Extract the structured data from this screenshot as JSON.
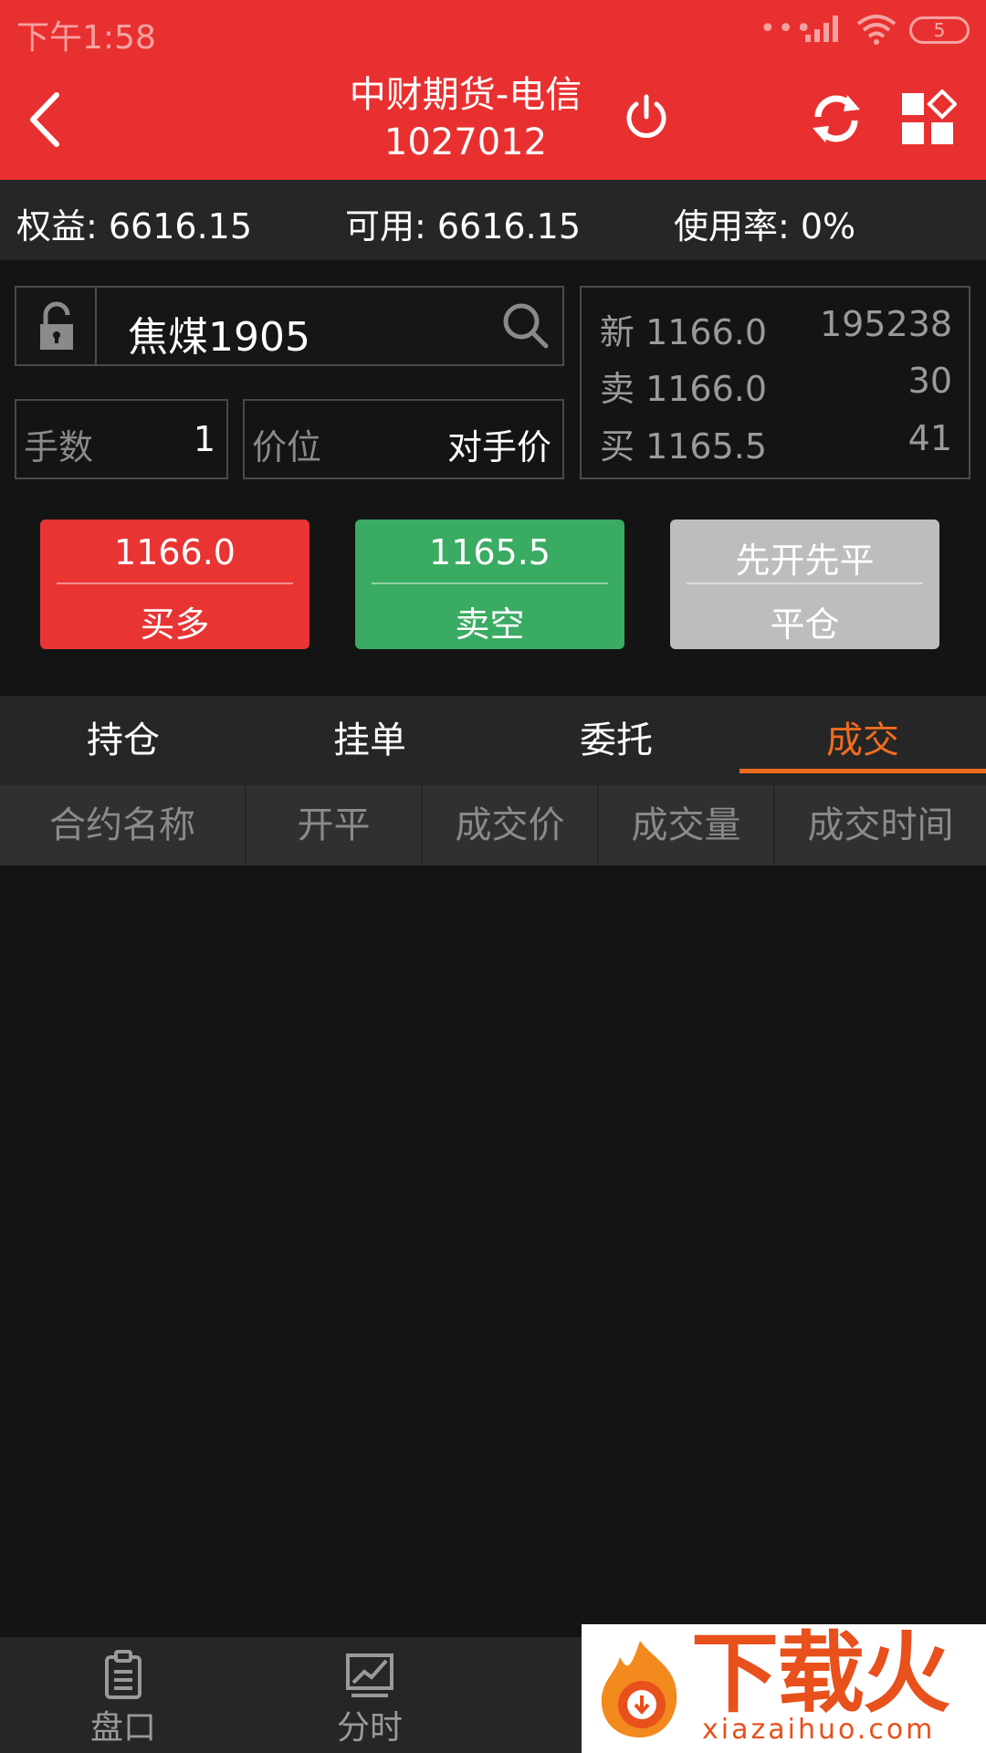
{
  "status_bar": {
    "time": "下午1:58",
    "dots": "•••",
    "battery": "5"
  },
  "header": {
    "title": "中财期货-电信1027012",
    "colors": {
      "bg": "#e93030"
    }
  },
  "account": {
    "equity": "权益: 6616.15",
    "available": "可用: 6616.15",
    "usage": "使用率: 0%"
  },
  "order": {
    "symbol": "焦煤1905",
    "qty_label": "手数",
    "qty_value": "1",
    "price_label": "价位",
    "price_value": "对手价"
  },
  "quote": {
    "rows": [
      {
        "label": "新 1166.0",
        "volume": "195238"
      },
      {
        "label": "卖 1166.0",
        "volume": "30"
      },
      {
        "label": "买 1165.5",
        "volume": "41"
      }
    ]
  },
  "actions": {
    "buy": {
      "price": "1166.0",
      "label": "买多",
      "color": "#e93434"
    },
    "sell": {
      "price": "1165.5",
      "label": "卖空",
      "color": "#3aab62"
    },
    "close": {
      "price": "先开先平",
      "label": "平仓",
      "color": "#bdbdbd"
    }
  },
  "tabs": [
    {
      "label": "持仓"
    },
    {
      "label": "挂单"
    },
    {
      "label": "委托"
    },
    {
      "label": "成交",
      "active": true
    }
  ],
  "table": {
    "columns": [
      "合约名称",
      "开平",
      "成交价",
      "成交量",
      "成交时间"
    ],
    "rows": []
  },
  "bottom_nav": [
    {
      "label": "盘口",
      "icon": "clipboard-icon"
    },
    {
      "label": "分时",
      "icon": "chart-icon"
    }
  ],
  "watermark": {
    "text": "下载火",
    "url": "xiazaihuo.com"
  },
  "accent": "#ef6c1f"
}
